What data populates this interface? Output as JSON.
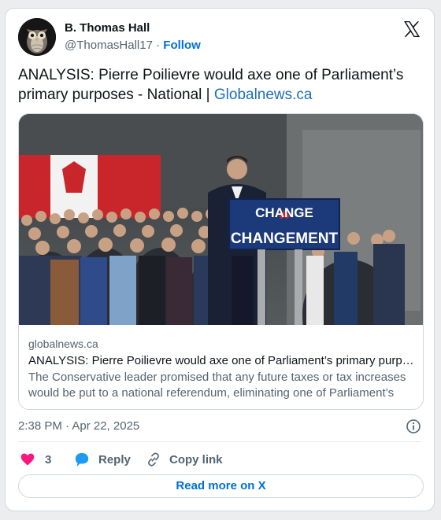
{
  "author": {
    "name": "B. Thomas Hall",
    "handle": "@ThomasHall17",
    "separator": "·",
    "follow_label": "Follow"
  },
  "tweet": {
    "text": "ANALYSIS: Pierre Poilievre would axe one of Parliament’s primary purposes - National | ",
    "link_text": "Globalnews.ca"
  },
  "link_card": {
    "domain": "globalnews.ca",
    "title": "ANALYSIS: Pierre Poilievre would axe one of Parliament’s primary purposes - National",
    "description": "The Conservative leader promised that any future taxes or tax increases would be put to a national referendum, eliminating one of Parliament’s primary purposes.",
    "image": {
      "podium_line1": "CHANGE",
      "podium_line2": "CHANGEMENT"
    }
  },
  "timestamp": "2:38 PM · Apr 22, 2025",
  "actions": {
    "like_count": "3",
    "reply_label": "Reply",
    "copy_label": "Copy link"
  },
  "read_more_label": "Read more on X",
  "colors": {
    "accent": "#006fd6",
    "like": "#f91880",
    "reply": "#1d9bf0",
    "secondary_text": "#536471"
  },
  "icons": [
    "owl-avatar",
    "x-logo-icon",
    "info-icon",
    "heart-icon",
    "reply-bubble-icon",
    "link-icon"
  ]
}
